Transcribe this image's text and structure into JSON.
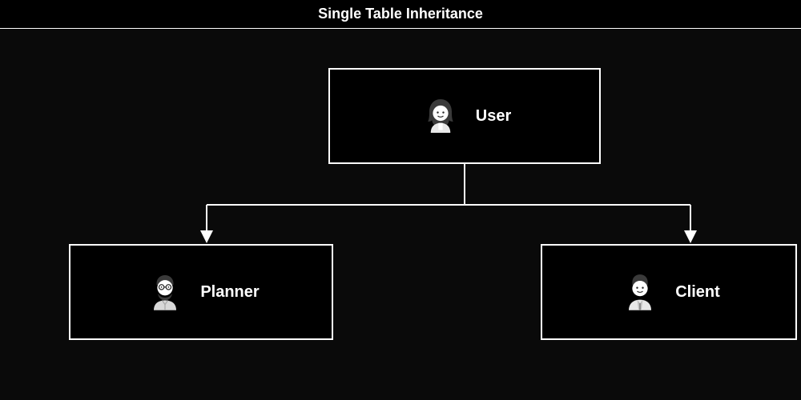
{
  "title": "Single Table Inheritance",
  "nodes": {
    "parent": {
      "label": "User",
      "icon": "user-female"
    },
    "child_left": {
      "label": "Planner",
      "icon": "user-glasses"
    },
    "child_right": {
      "label": "Client",
      "icon": "user-male"
    }
  }
}
